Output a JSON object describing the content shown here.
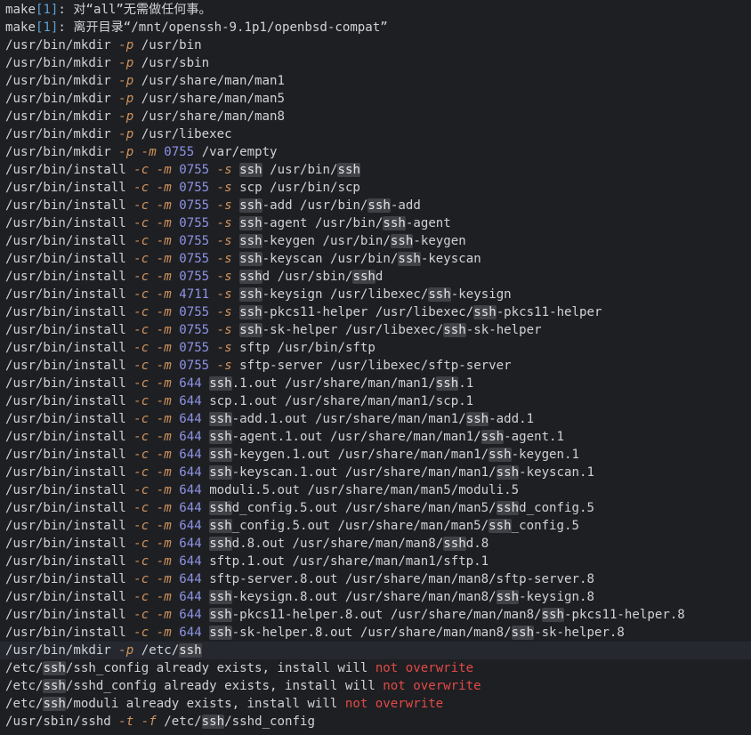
{
  "theme": {
    "background": "#1e1f22",
    "text": "#cfd2d6",
    "flag": "#d1945e",
    "number": "#8d93e6",
    "make_bracket": "#5f9fd4",
    "warning": "#e24a47",
    "search_highlight": "#3f4147"
  },
  "search_term": "ssh",
  "lines": [
    {
      "kind": "text",
      "current": false,
      "segments": [
        {
          "t": "make",
          "s": "text"
        },
        {
          "t": "[1]",
          "s": "mkn"
        },
        {
          "t": ": 对“all”无需做任何事。",
          "s": "text"
        }
      ]
    },
    {
      "kind": "text",
      "current": false,
      "segments": [
        {
          "t": "make",
          "s": "text"
        },
        {
          "t": "[1]",
          "s": "mkn"
        },
        {
          "t": ": 离开目录“/mnt/openssh-9.1p1/openbsd-compat”",
          "s": "text"
        }
      ]
    },
    {
      "kind": "text",
      "current": false,
      "segments": [
        {
          "t": "/usr/bin/mkdir ",
          "s": "text"
        },
        {
          "t": "-p",
          "s": "flag"
        },
        {
          "t": " /usr/bin",
          "s": "text"
        }
      ]
    },
    {
      "kind": "text",
      "current": false,
      "segments": [
        {
          "t": "/usr/bin/mkdir ",
          "s": "text"
        },
        {
          "t": "-p",
          "s": "flag"
        },
        {
          "t": " /usr/sbin",
          "s": "text"
        }
      ]
    },
    {
      "kind": "text",
      "current": false,
      "segments": [
        {
          "t": "/usr/bin/mkdir ",
          "s": "text"
        },
        {
          "t": "-p",
          "s": "flag"
        },
        {
          "t": " /usr/share/man/man1",
          "s": "text"
        }
      ]
    },
    {
      "kind": "text",
      "current": false,
      "segments": [
        {
          "t": "/usr/bin/mkdir ",
          "s": "text"
        },
        {
          "t": "-p",
          "s": "flag"
        },
        {
          "t": " /usr/share/man/man5",
          "s": "text"
        }
      ]
    },
    {
      "kind": "text",
      "current": false,
      "segments": [
        {
          "t": "/usr/bin/mkdir ",
          "s": "text"
        },
        {
          "t": "-p",
          "s": "flag"
        },
        {
          "t": " /usr/share/man/man8",
          "s": "text"
        }
      ]
    },
    {
      "kind": "text",
      "current": false,
      "segments": [
        {
          "t": "/usr/bin/mkdir ",
          "s": "text"
        },
        {
          "t": "-p",
          "s": "flag"
        },
        {
          "t": " /usr/libexec",
          "s": "text"
        }
      ]
    },
    {
      "kind": "text",
      "current": false,
      "segments": [
        {
          "t": "/usr/bin/mkdir ",
          "s": "text"
        },
        {
          "t": "-p",
          "s": "flag"
        },
        {
          "t": " ",
          "s": "text"
        },
        {
          "t": "-m",
          "s": "flag"
        },
        {
          "t": " ",
          "s": "text"
        },
        {
          "t": "0755",
          "s": "num"
        },
        {
          "t": " /var/empty",
          "s": "text"
        }
      ]
    },
    {
      "kind": "install",
      "current": false,
      "mode": "0755",
      "smode": true,
      "args": "ssh /usr/bin/ssh"
    },
    {
      "kind": "install",
      "current": false,
      "mode": "0755",
      "smode": true,
      "args": "scp /usr/bin/scp"
    },
    {
      "kind": "install",
      "current": false,
      "mode": "0755",
      "smode": true,
      "args": "ssh-add /usr/bin/ssh-add"
    },
    {
      "kind": "install",
      "current": false,
      "mode": "0755",
      "smode": true,
      "args": "ssh-agent /usr/bin/ssh-agent"
    },
    {
      "kind": "install",
      "current": false,
      "mode": "0755",
      "smode": true,
      "args": "ssh-keygen /usr/bin/ssh-keygen"
    },
    {
      "kind": "install",
      "current": false,
      "mode": "0755",
      "smode": true,
      "args": "ssh-keyscan /usr/bin/ssh-keyscan"
    },
    {
      "kind": "install",
      "current": false,
      "mode": "0755",
      "smode": true,
      "args": "sshd /usr/sbin/sshd"
    },
    {
      "kind": "install",
      "current": false,
      "mode": "4711",
      "smode": true,
      "args": "ssh-keysign /usr/libexec/ssh-keysign"
    },
    {
      "kind": "install",
      "current": false,
      "mode": "0755",
      "smode": true,
      "args": "ssh-pkcs11-helper /usr/libexec/ssh-pkcs11-helper"
    },
    {
      "kind": "install",
      "current": false,
      "mode": "0755",
      "smode": true,
      "args": "ssh-sk-helper /usr/libexec/ssh-sk-helper"
    },
    {
      "kind": "install",
      "current": false,
      "mode": "0755",
      "smode": true,
      "args": "sftp /usr/bin/sftp"
    },
    {
      "kind": "install",
      "current": false,
      "mode": "0755",
      "smode": true,
      "args": "sftp-server /usr/libexec/sftp-server"
    },
    {
      "kind": "install",
      "current": false,
      "mode": "644",
      "smode": false,
      "args": "ssh.1.out /usr/share/man/man1/ssh.1"
    },
    {
      "kind": "install",
      "current": false,
      "mode": "644",
      "smode": false,
      "args": "scp.1.out /usr/share/man/man1/scp.1"
    },
    {
      "kind": "install",
      "current": false,
      "mode": "644",
      "smode": false,
      "args": "ssh-add.1.out /usr/share/man/man1/ssh-add.1"
    },
    {
      "kind": "install",
      "current": false,
      "mode": "644",
      "smode": false,
      "args": "ssh-agent.1.out /usr/share/man/man1/ssh-agent.1"
    },
    {
      "kind": "install",
      "current": false,
      "mode": "644",
      "smode": false,
      "args": "ssh-keygen.1.out /usr/share/man/man1/ssh-keygen.1"
    },
    {
      "kind": "install",
      "current": false,
      "mode": "644",
      "smode": false,
      "args": "ssh-keyscan.1.out /usr/share/man/man1/ssh-keyscan.1"
    },
    {
      "kind": "install",
      "current": false,
      "mode": "644",
      "smode": false,
      "args": "moduli.5.out /usr/share/man/man5/moduli.5"
    },
    {
      "kind": "install",
      "current": false,
      "mode": "644",
      "smode": false,
      "args": "sshd_config.5.out /usr/share/man/man5/sshd_config.5"
    },
    {
      "kind": "install",
      "current": false,
      "mode": "644",
      "smode": false,
      "args": "ssh_config.5.out /usr/share/man/man5/ssh_config.5"
    },
    {
      "kind": "install",
      "current": false,
      "mode": "644",
      "smode": false,
      "args": "sshd.8.out /usr/share/man/man8/sshd.8"
    },
    {
      "kind": "install",
      "current": false,
      "mode": "644",
      "smode": false,
      "args": "sftp.1.out /usr/share/man/man1/sftp.1"
    },
    {
      "kind": "install",
      "current": false,
      "mode": "644",
      "smode": false,
      "args": "sftp-server.8.out /usr/share/man/man8/sftp-server.8"
    },
    {
      "kind": "install",
      "current": false,
      "mode": "644",
      "smode": false,
      "args": "ssh-keysign.8.out /usr/share/man/man8/ssh-keysign.8"
    },
    {
      "kind": "install",
      "current": false,
      "mode": "644",
      "smode": false,
      "args": "ssh-pkcs11-helper.8.out /usr/share/man/man8/ssh-pkcs11-helper.8"
    },
    {
      "kind": "install",
      "current": false,
      "mode": "644",
      "smode": false,
      "args": "ssh-sk-helper.8.out /usr/share/man/man8/ssh-sk-helper.8"
    },
    {
      "kind": "text",
      "current": true,
      "segments": [
        {
          "t": "/usr/bin/mkdir ",
          "s": "text"
        },
        {
          "t": "-p",
          "s": "flag"
        },
        {
          "t": " /etc/",
          "s": "text"
        },
        {
          "t": "ssh",
          "s": "hl"
        }
      ]
    },
    {
      "kind": "text",
      "current": false,
      "segments": [
        {
          "t": "/etc/",
          "s": "text"
        },
        {
          "t": "ssh",
          "s": "hl"
        },
        {
          "t": "/ssh_config already exists, install will ",
          "s": "text"
        },
        {
          "t": "not overwrite",
          "s": "warn"
        }
      ]
    },
    {
      "kind": "text",
      "current": false,
      "segments": [
        {
          "t": "/etc/",
          "s": "text"
        },
        {
          "t": "ssh",
          "s": "hl"
        },
        {
          "t": "/sshd_config already exists, install will ",
          "s": "text"
        },
        {
          "t": "not overwrite",
          "s": "warn"
        }
      ]
    },
    {
      "kind": "text",
      "current": false,
      "segments": [
        {
          "t": "/etc/",
          "s": "text"
        },
        {
          "t": "ssh",
          "s": "hl"
        },
        {
          "t": "/moduli already exists, install will ",
          "s": "text"
        },
        {
          "t": "not overwrite",
          "s": "warn"
        }
      ]
    },
    {
      "kind": "text",
      "current": false,
      "segments": [
        {
          "t": "/usr/sbin/sshd ",
          "s": "text"
        },
        {
          "t": "-t",
          "s": "flag"
        },
        {
          "t": " ",
          "s": "text"
        },
        {
          "t": "-f",
          "s": "flag"
        },
        {
          "t": " /etc/",
          "s": "text"
        },
        {
          "t": "ssh",
          "s": "hl"
        },
        {
          "t": "/sshd_config",
          "s": "text"
        }
      ]
    }
  ]
}
